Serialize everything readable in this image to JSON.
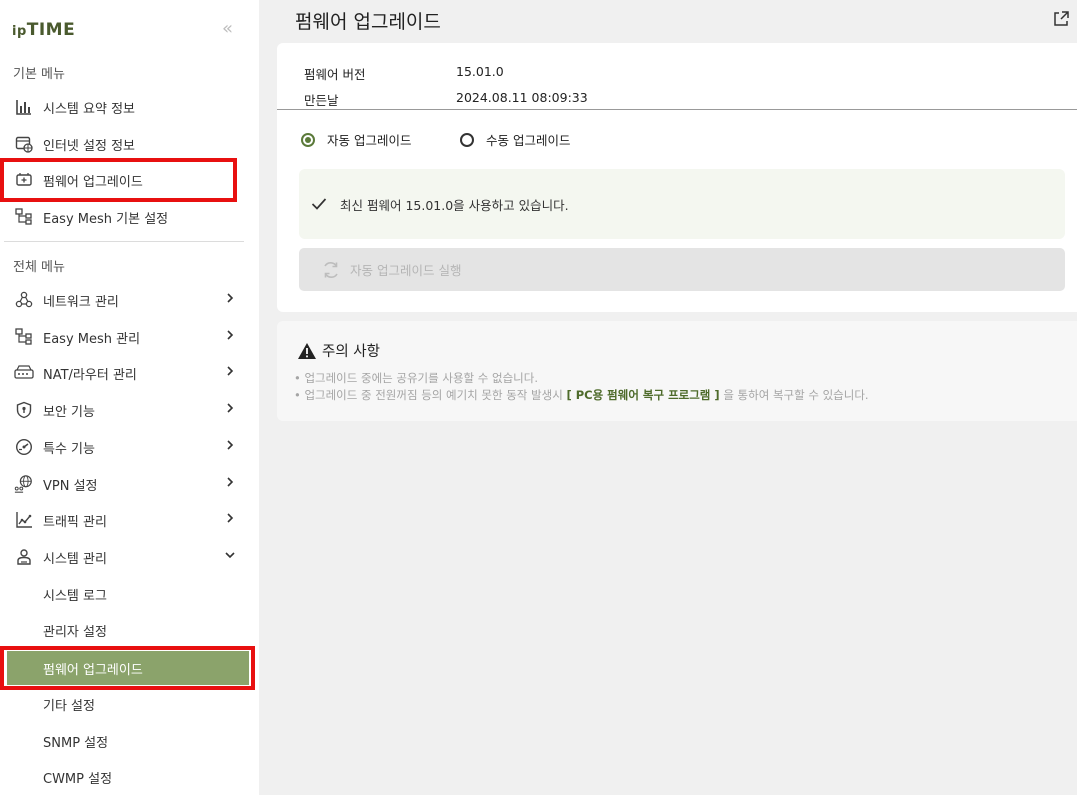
{
  "sidebar": {
    "logo_ip": "ip",
    "logo_time": "TIME",
    "collapse_glyph": "«",
    "section_basic": "기본 메뉴",
    "basic_items": [
      {
        "label": "시스템 요약 정보",
        "icon": "bar-chart-icon"
      },
      {
        "label": "인터넷 설정 정보",
        "icon": "internet-settings-icon"
      },
      {
        "label": "펌웨어 업그레이드",
        "icon": "firmware-icon"
      },
      {
        "label": "Easy Mesh 기본 설정",
        "icon": "mesh-icon"
      }
    ],
    "section_all": "전체 메뉴",
    "all_items": [
      {
        "label": "네트워크 관리",
        "icon": "network-icon"
      },
      {
        "label": "Easy Mesh 관리",
        "icon": "mesh-icon"
      },
      {
        "label": "NAT/라우터 관리",
        "icon": "router-icon"
      },
      {
        "label": "보안 기능",
        "icon": "shield-icon"
      },
      {
        "label": "특수 기능",
        "icon": "gauge-icon"
      },
      {
        "label": "VPN 설정",
        "icon": "vpn-globe-icon"
      },
      {
        "label": "트래픽 관리",
        "icon": "traffic-chart-icon"
      },
      {
        "label": "시스템 관리",
        "icon": "system-user-icon"
      }
    ],
    "system_sub_items": [
      {
        "label": "시스템 로그"
      },
      {
        "label": "관리자 설정"
      },
      {
        "label": "펌웨어 업그레이드"
      },
      {
        "label": "기타 설정"
      },
      {
        "label": "SNMP 설정"
      },
      {
        "label": "CWMP 설정"
      }
    ]
  },
  "main": {
    "title": "펌웨어 업그레이드",
    "firmware_version_label": "펌웨어 버전",
    "firmware_version_value": "15.01.0",
    "build_date_label": "만든날",
    "build_date_value": "2024.08.11 08:09:33",
    "radio_auto": "자동 업그레이드",
    "radio_manual": "수동 업그레이드",
    "selected_mode": "auto",
    "notice_text": "최신 펌웨어 15.01.0을 사용하고 있습니다.",
    "exec_button": "자동 업그레이드 실행",
    "warning_title": "주의 사항",
    "warning_line1": "• 업그레이드 중에는 공유기를 사용할 수 없습니다.",
    "warning_line2_pre": "• 업그레이드 중 전원꺼짐 등의 예기치 못한 동작 발생시",
    "warning_line2_link": "[ PC용 펌웨어 복구 프로그램 ]",
    "warning_line2_post": "을 통하여 복구할 수  있습니다."
  },
  "colors": {
    "accent": "#8ba36b",
    "brand_dark": "#4a5a2e",
    "highlight_red": "#e81010"
  }
}
